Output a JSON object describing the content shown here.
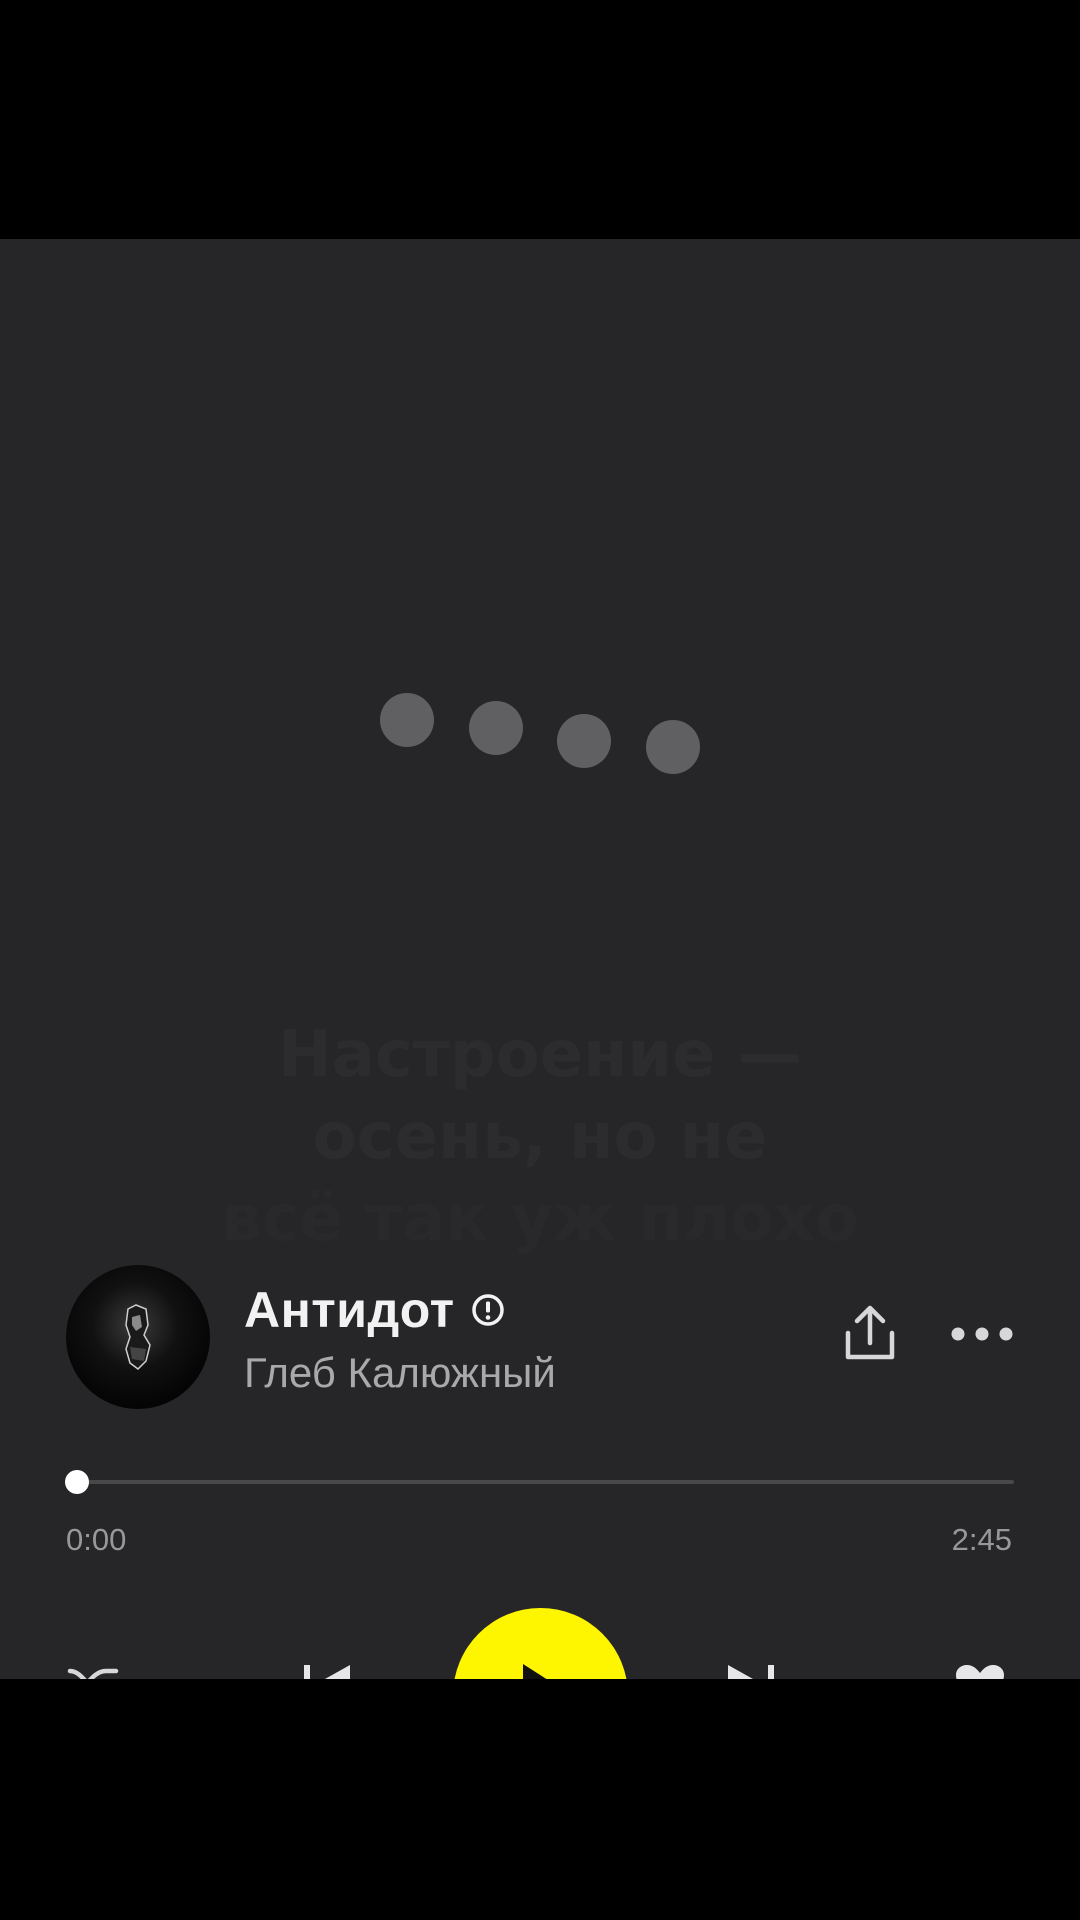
{
  "lyrics": {
    "line1": "Настроение —",
    "line2": "осень, но не",
    "line3": "всё так уж плохо"
  },
  "track": {
    "title": "Антидот",
    "artist": "Глеб Калюжный",
    "explicit": true
  },
  "progress": {
    "current": "0:00",
    "total": "2:45",
    "fraction": 0.0
  },
  "colors": {
    "background": "#262628",
    "accent": "#fdf600"
  },
  "icons": {
    "share": "share-icon",
    "more": "more-dots-icon",
    "explicit": "explicit-icon",
    "shuffle": "shuffle-icon",
    "previous": "previous-track-icon",
    "play": "play-icon",
    "next": "next-track-icon",
    "like": "heart-icon"
  }
}
